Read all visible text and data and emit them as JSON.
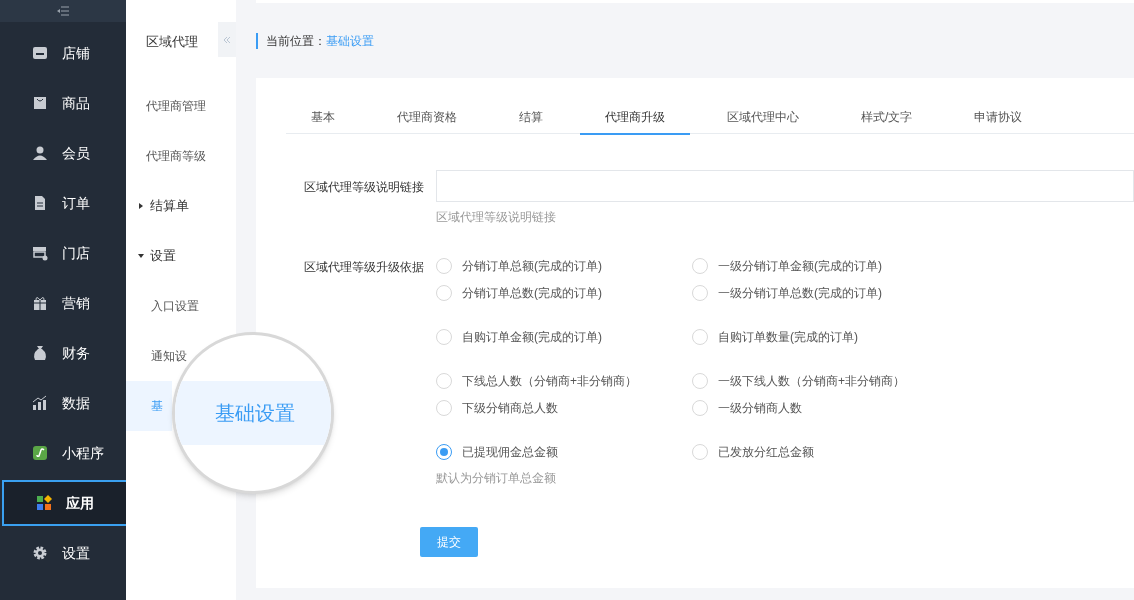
{
  "sidebar": {
    "items": [
      {
        "label": "店铺",
        "selected": false
      },
      {
        "label": "商品",
        "selected": false
      },
      {
        "label": "会员",
        "selected": false
      },
      {
        "label": "订单",
        "selected": false
      },
      {
        "label": "门店",
        "selected": false
      },
      {
        "label": "营销",
        "selected": false
      },
      {
        "label": "财务",
        "selected": false
      },
      {
        "label": "数据",
        "selected": false
      },
      {
        "label": "小程序",
        "selected": false
      },
      {
        "label": "应用",
        "selected": true
      },
      {
        "label": "设置",
        "selected": false
      }
    ]
  },
  "subnav": {
    "title": "区域代理",
    "items": [
      {
        "label": "代理商管理",
        "kind": "link",
        "selected": false
      },
      {
        "label": "代理商等级",
        "kind": "link",
        "selected": false
      },
      {
        "label": "结算单",
        "kind": "group",
        "expanded": false
      },
      {
        "label": "设置",
        "kind": "group",
        "expanded": true
      },
      {
        "label": "入口设置",
        "kind": "child",
        "selected": false
      },
      {
        "label": "通知设",
        "kind": "child",
        "selected": false
      },
      {
        "label": "基",
        "kind": "child",
        "selected": true
      }
    ]
  },
  "magnifier": {
    "label": "基础设置"
  },
  "breadcrumb": {
    "label": "当前位置：",
    "current": "基础设置"
  },
  "tabs": [
    {
      "label": "基本",
      "selected": false
    },
    {
      "label": "代理商资格",
      "selected": false
    },
    {
      "label": "结算",
      "selected": false
    },
    {
      "label": "代理商升级",
      "selected": true
    },
    {
      "label": "区域代理中心",
      "selected": false
    },
    {
      "label": "样式/文字",
      "selected": false
    },
    {
      "label": "申请协议",
      "selected": false
    }
  ],
  "link_field": {
    "label": "区域代理等级说明链接",
    "hint": "区域代理等级说明链接"
  },
  "upgrade_basis": {
    "label": "区域代理等级升级依据",
    "hint": "默认为分销订单总金额",
    "groups": [
      [
        [
          {
            "label": "分销订单总额(完成的订单)",
            "selected": false
          },
          {
            "label": "一级分销订单金额(完成的订单)",
            "selected": false
          }
        ],
        [
          {
            "label": "分销订单总数(完成的订单)",
            "selected": false
          },
          {
            "label": "一级分销订单总数(完成的订单)",
            "selected": false
          }
        ]
      ],
      [
        [
          {
            "label": "自购订单金额(完成的订单)",
            "selected": false
          },
          {
            "label": "自购订单数量(完成的订单)",
            "selected": false
          }
        ]
      ],
      [
        [
          {
            "label": "下线总人数（分销商+非分销商）",
            "selected": false
          },
          {
            "label": "一级下线人数（分销商+非分销商）",
            "selected": false
          }
        ],
        [
          {
            "label": "下级分销商总人数",
            "selected": false
          },
          {
            "label": "一级分销商人数",
            "selected": false
          }
        ]
      ],
      [
        [
          {
            "label": "已提现佣金总金额",
            "selected": true
          },
          {
            "label": "已发放分红总金额",
            "selected": false
          }
        ]
      ]
    ]
  },
  "submit": "提交"
}
